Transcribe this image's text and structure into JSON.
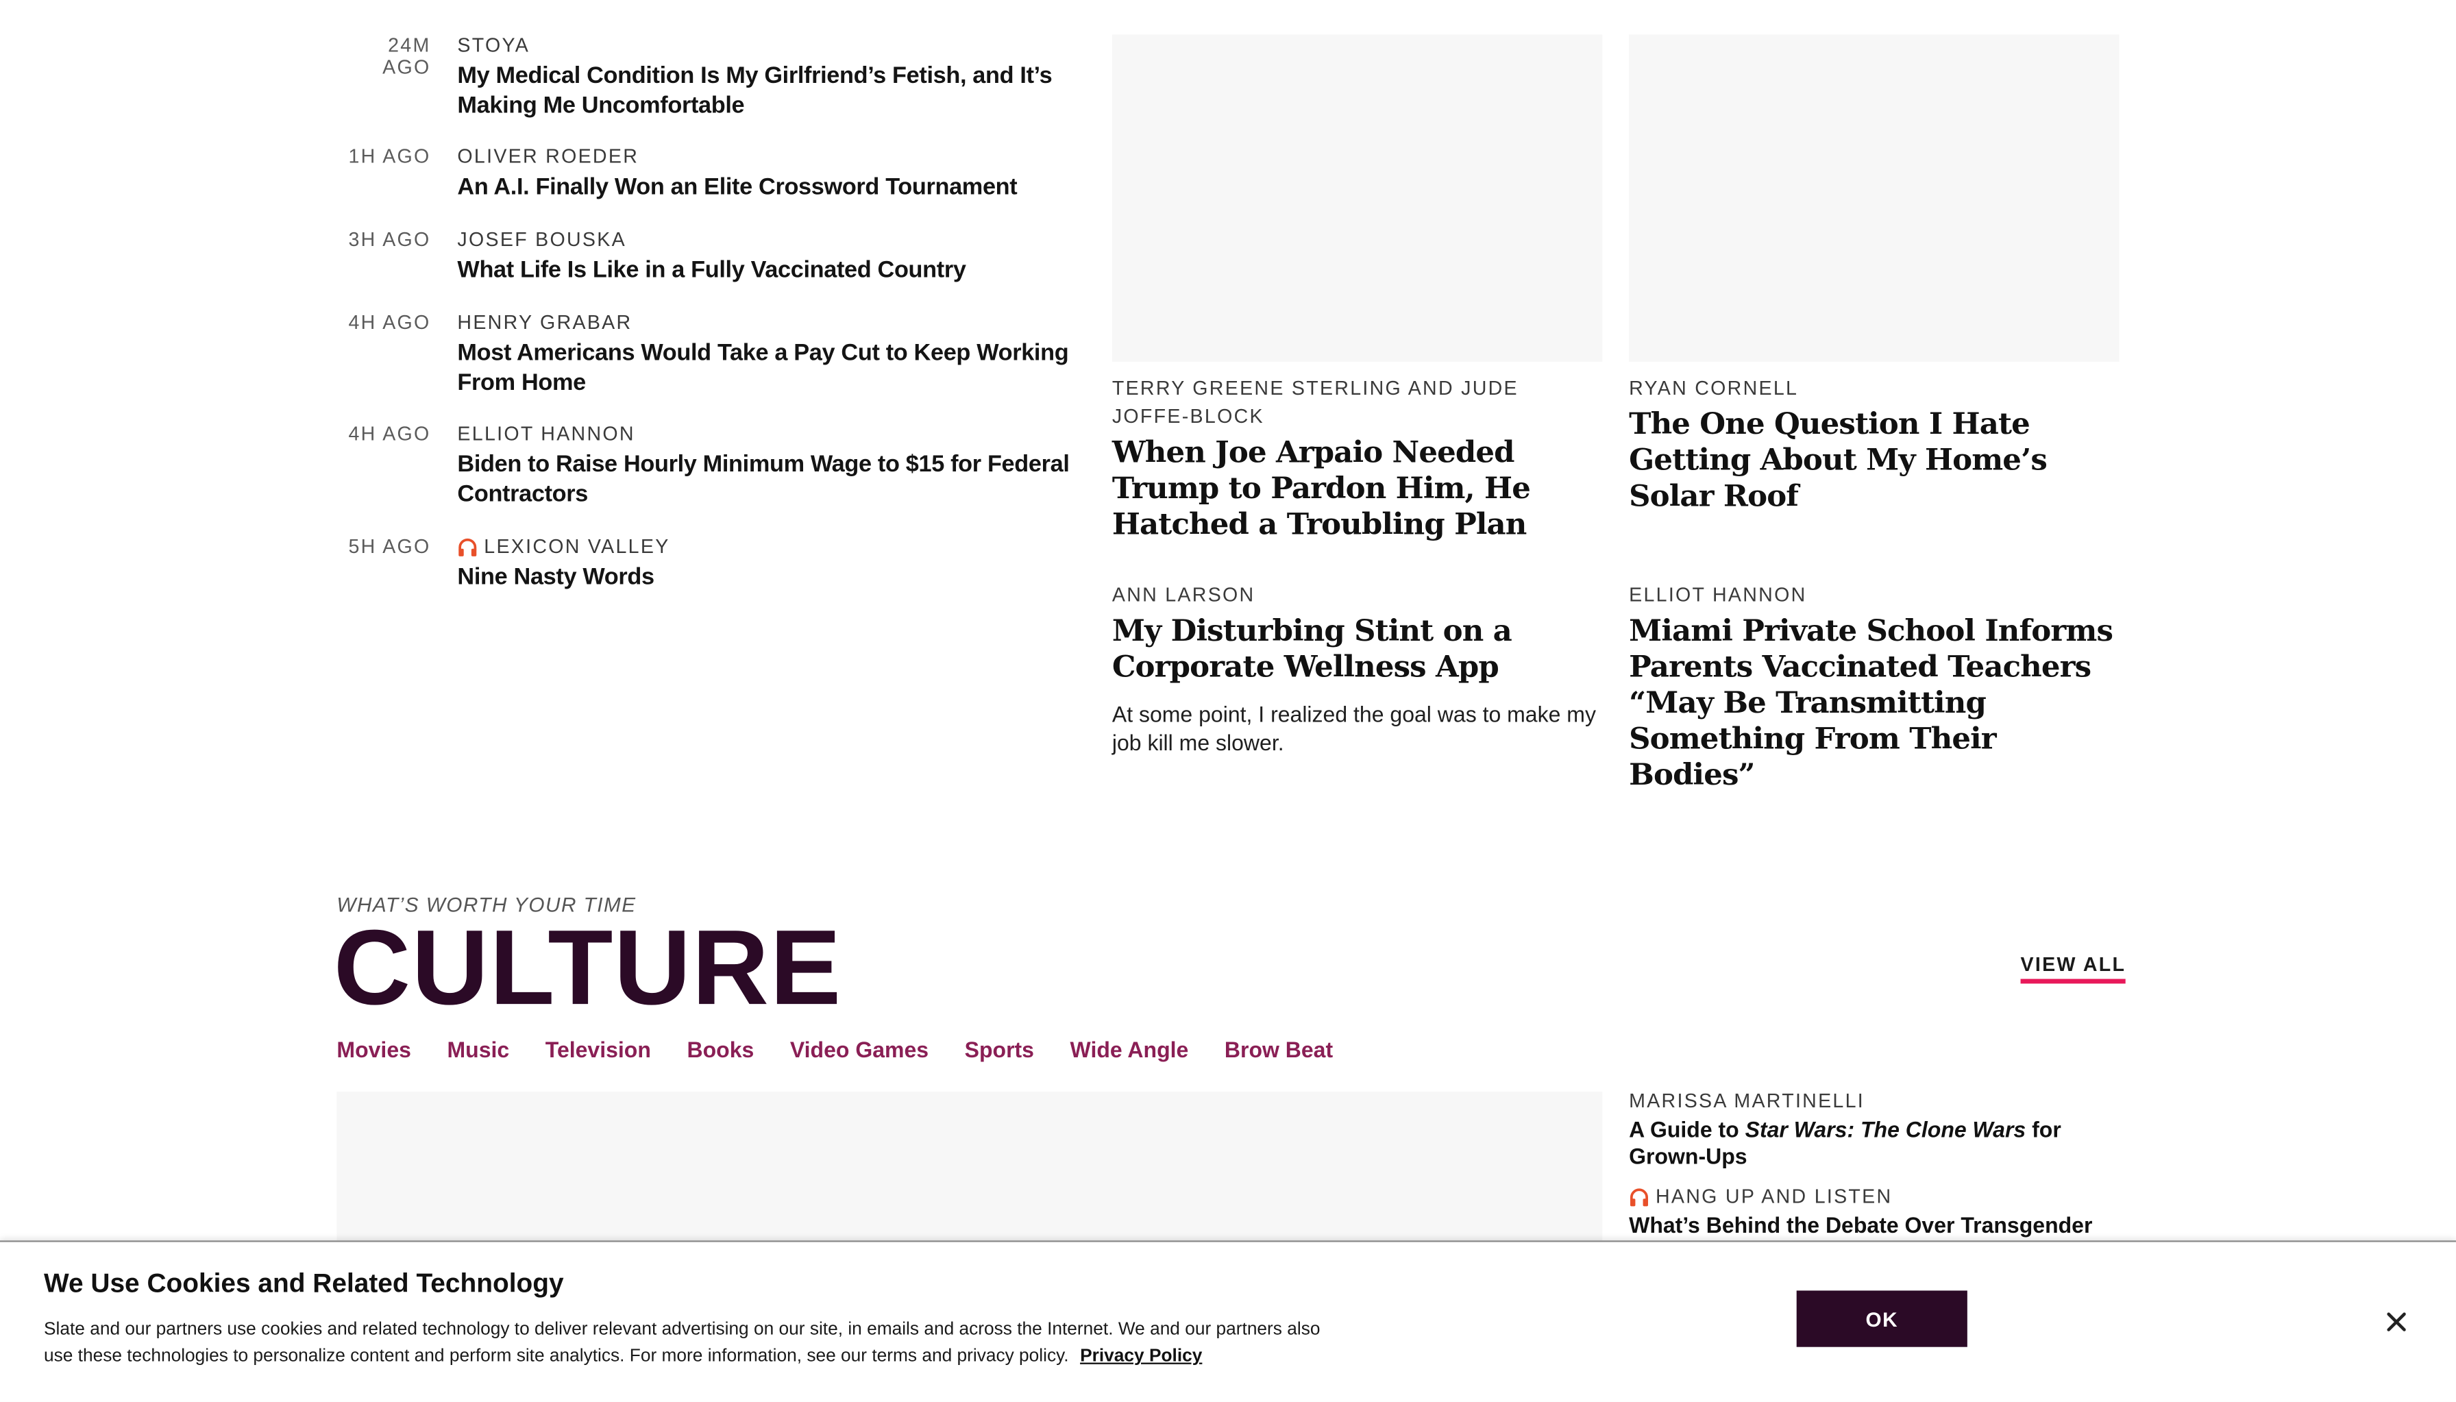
{
  "latest": [
    {
      "time": "24M AGO",
      "author": "STOYA",
      "title": "My Medical Condition Is My Girlfriend’s Fetish, and It’s Making Me Uncomfortable",
      "podcast": false
    },
    {
      "time": "1H AGO",
      "author": "OLIVER ROEDER",
      "title": "An A.I. Finally Won an Elite Crossword Tournament",
      "podcast": false
    },
    {
      "time": "3H AGO",
      "author": "JOSEF BOUSKA",
      "title": "What Life Is Like in a Fully Vaccinated Country",
      "podcast": false
    },
    {
      "time": "4H AGO",
      "author": "HENRY GRABAR",
      "title": "Most Americans Would Take a Pay Cut to Keep Working From Home",
      "podcast": false
    },
    {
      "time": "4H AGO",
      "author": "ELLIOT HANNON",
      "title": "Biden to Raise Hourly Minimum Wage to $15 for Federal Contractors",
      "podcast": false
    },
    {
      "time": "5H AGO",
      "author": "LEXICON VALLEY",
      "title": "Nine Nasty Words",
      "podcast": true
    }
  ],
  "stories": [
    {
      "author": "TERRY GREENE STERLING AND JUDE JOFFE-BLOCK",
      "title": "When Joe Arpaio Needed Trump to Pardon Him, He Hatched a Troubling Plan",
      "dek": ""
    },
    {
      "author": "RYAN CORNELL",
      "title": "The One Question I Hate Getting About My Home’s Solar Roof",
      "dek": ""
    },
    {
      "author": "ANN LARSON",
      "title": "My Disturbing Stint on a Corporate Wellness App",
      "dek": "At some point, I realized the goal was to make my job kill me slower."
    },
    {
      "author": "ELLIOT HANNON",
      "title": "Miami Private School Informs Parents Vaccinated Teachers “May Be Transmitting Something From Their Bodies”",
      "dek": ""
    }
  ],
  "culture": {
    "kicker": "WHAT’S WORTH YOUR TIME",
    "title": "CULTURE",
    "view_all": "VIEW ALL",
    "subnav": [
      "Movies",
      "Music",
      "Television",
      "Books",
      "Video Games",
      "Sports",
      "Wide Angle",
      "Brow Beat"
    ],
    "side_stories": [
      {
        "author": "MARISSA MARTINELLI",
        "title_prefix": "A Guide to ",
        "title_italic": "Star Wars: The Clone Wars",
        "title_suffix": " for Grown-Ups",
        "podcast": false
      },
      {
        "author": "HANG UP AND LISTEN",
        "title": "What’s Behind the Debate Over Transgender Girls",
        "podcast": true
      }
    ]
  },
  "cookie": {
    "title": "We Use Cookies and Related Technology",
    "text": "Slate and our partners use cookies and related technology to deliver relevant advertising on our site, in emails and across the Internet. We and our partners also use these technologies to personalize content and perform site analytics. For more information, see our terms and privacy policy.",
    "privacy_link": "Privacy Policy",
    "ok_label": "OK"
  },
  "colors": {
    "brand_dark": "#2b0a26",
    "subnav": "#8a1f55",
    "accent_underline": "#e8195a",
    "podcast_icon": "#e8502a"
  },
  "icons": {
    "podcast": "headphones-icon",
    "close": "close-icon"
  }
}
